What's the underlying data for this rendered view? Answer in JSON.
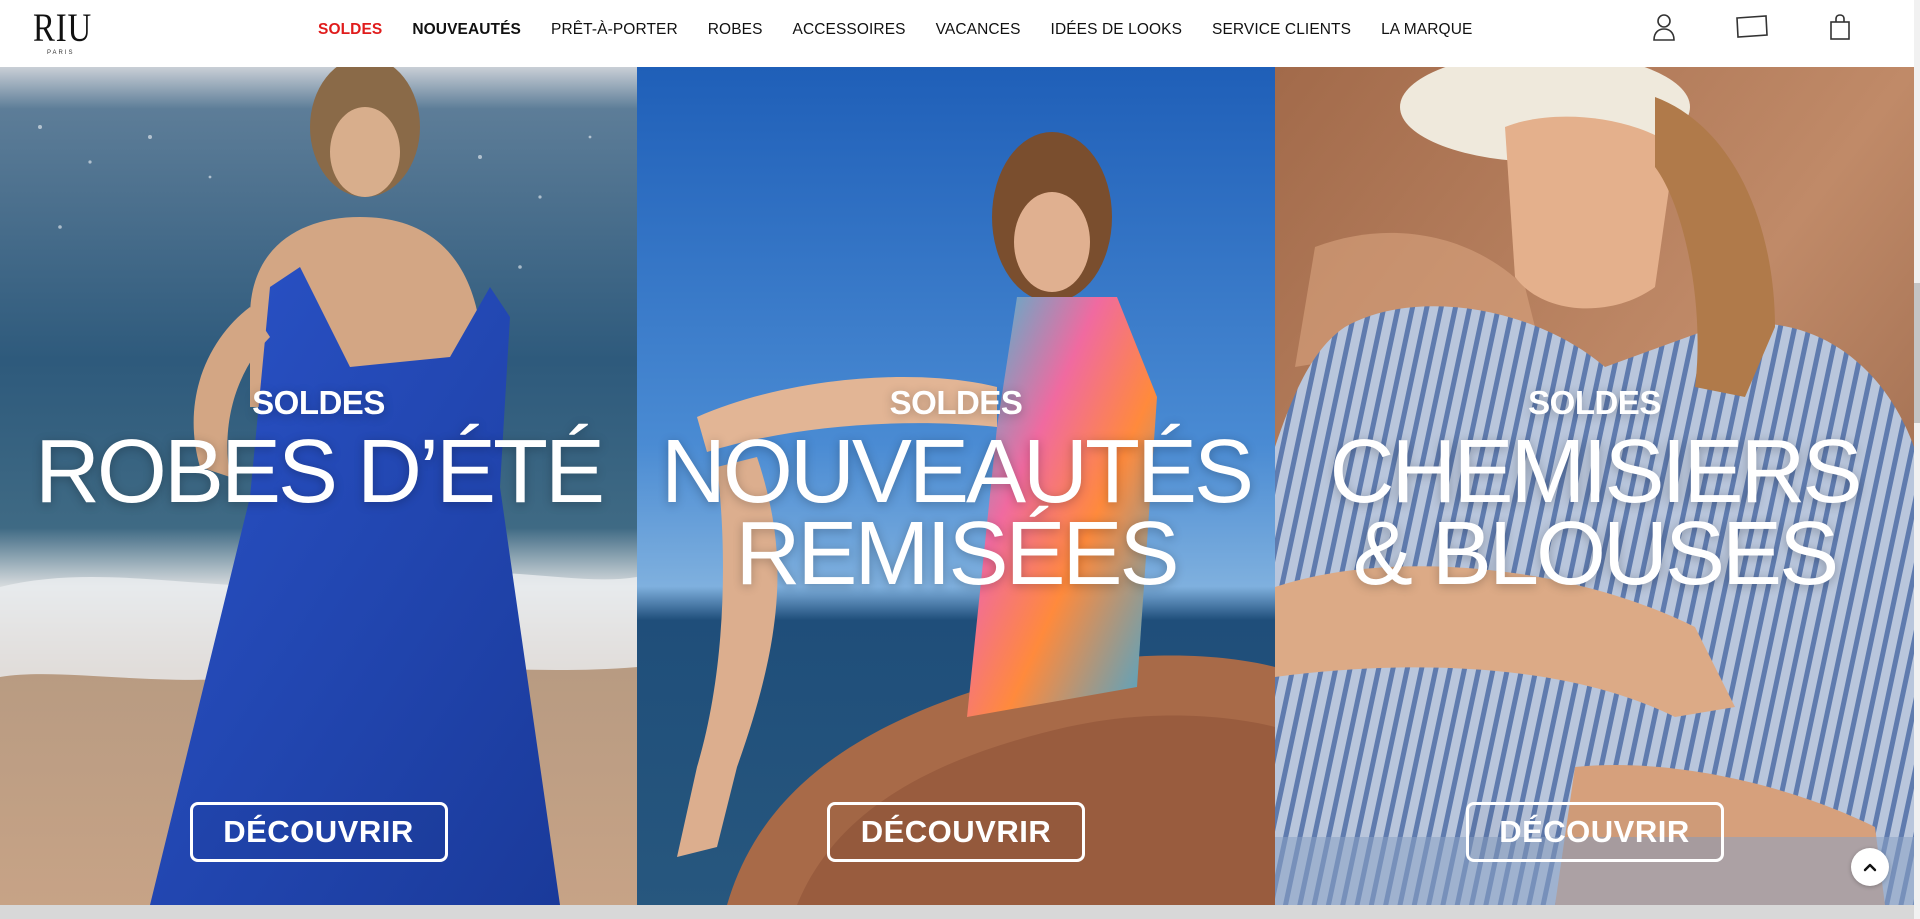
{
  "brand": {
    "logo_text": "RIU",
    "logo_subtext": "PARIS"
  },
  "nav": {
    "items": [
      {
        "label": "SOLDES",
        "style": "sale"
      },
      {
        "label": "NOUVEAUTÉS",
        "style": "bold"
      },
      {
        "label": "PRÊT-À-PORTER",
        "style": "normal"
      },
      {
        "label": "ROBES",
        "style": "normal"
      },
      {
        "label": "ACCESSOIRES",
        "style": "normal"
      },
      {
        "label": "VACANCES",
        "style": "normal"
      },
      {
        "label": "IDÉES DE LOOKS",
        "style": "normal"
      },
      {
        "label": "SERVICE CLIENTS",
        "style": "normal"
      },
      {
        "label": "LA MARQUE",
        "style": "normal"
      }
    ],
    "sale_color": "#e01c1c"
  },
  "header_icons": [
    "account-icon",
    "gift-card-icon",
    "shopping-bag-icon"
  ],
  "panels": [
    {
      "kicker": "SOLDES",
      "headline": "ROBES D’ÉTÉ",
      "cta": "DÉCOUVRIR",
      "scene": "beach-blue-dress"
    },
    {
      "kicker": "SOLDES",
      "headline": "NOUVEAUTÉS REMISÉES",
      "cta": "DÉCOUVRIR",
      "scene": "sky-rock-scarf"
    },
    {
      "kicker": "SOLDES",
      "headline": "CHEMISIERS & BLOUSES",
      "cta": "DÉCOUVRIR",
      "scene": "striped-shirt-cap"
    }
  ],
  "back_to_top_icon": "chevron-up-icon"
}
